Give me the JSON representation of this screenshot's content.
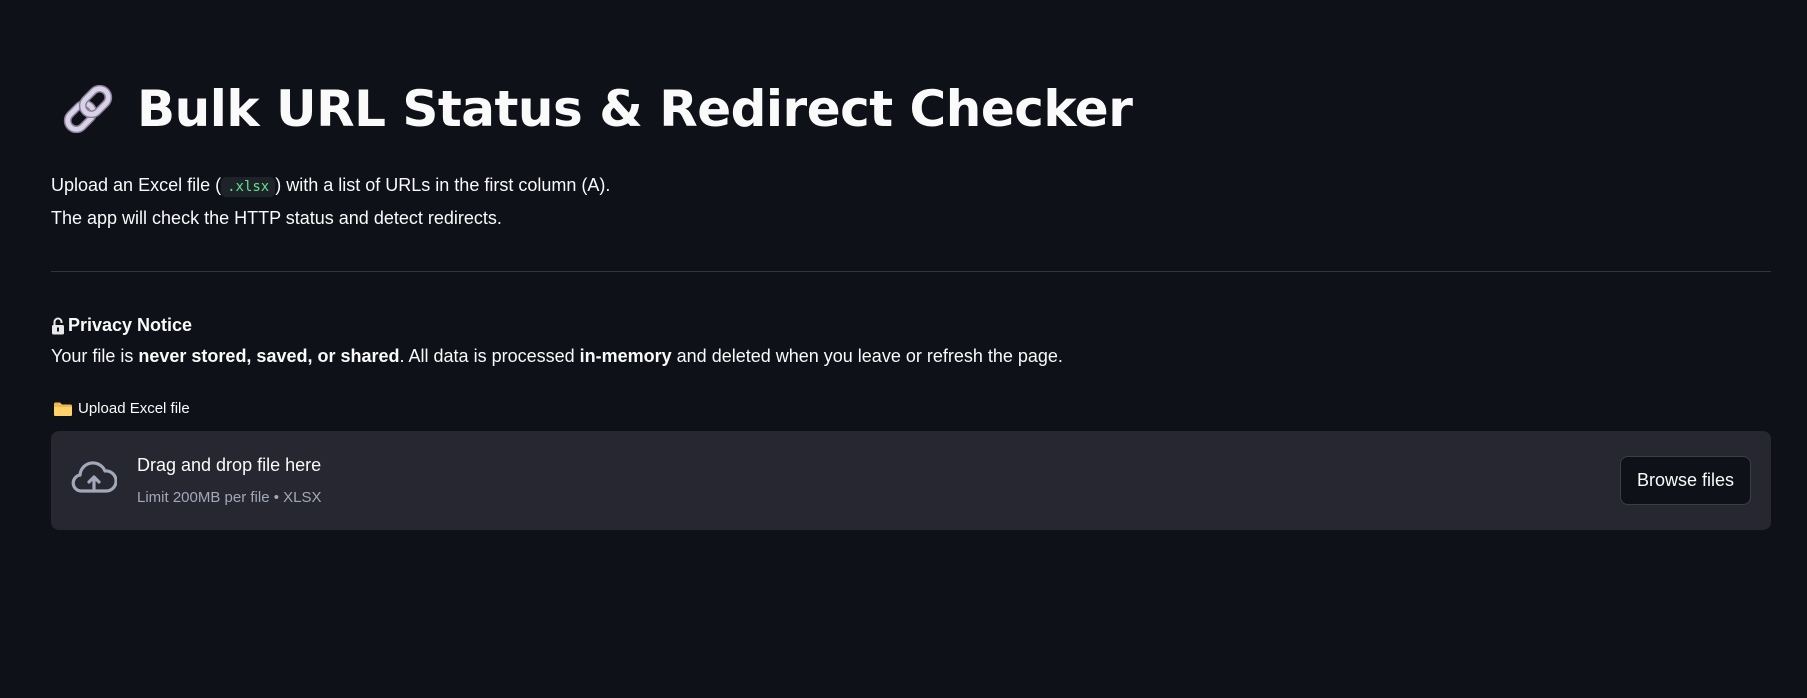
{
  "header": {
    "title_icon": "link-icon",
    "title": "Bulk URL Status & Redirect Checker"
  },
  "intro": {
    "line1_before": "Upload an Excel file (",
    "line1_code": ".xlsx",
    "line1_after": ") with a list of URLs in the first column (A).",
    "line2": "The app will check the HTTP status and detect redirects."
  },
  "privacy": {
    "icon": "lock-icon",
    "title": "Privacy Notice",
    "text_1": "Your file is ",
    "bold_1": "never stored, saved, or shared",
    "text_2": ". All data is processed ",
    "bold_2": "in-memory",
    "text_3": " and deleted when you leave or refresh the page."
  },
  "uploader": {
    "label_icon": "folder-icon",
    "label": "Upload Excel file",
    "drop_icon": "cloud-upload-icon",
    "drop_title": "Drag and drop file here",
    "drop_subtitle": "Limit 200MB per file • XLSX",
    "browse_label": "Browse files"
  },
  "colors": {
    "background": "#0e1117",
    "panel": "#262730",
    "code_text": "#5ce488",
    "muted_text": "#a3a8b8"
  }
}
